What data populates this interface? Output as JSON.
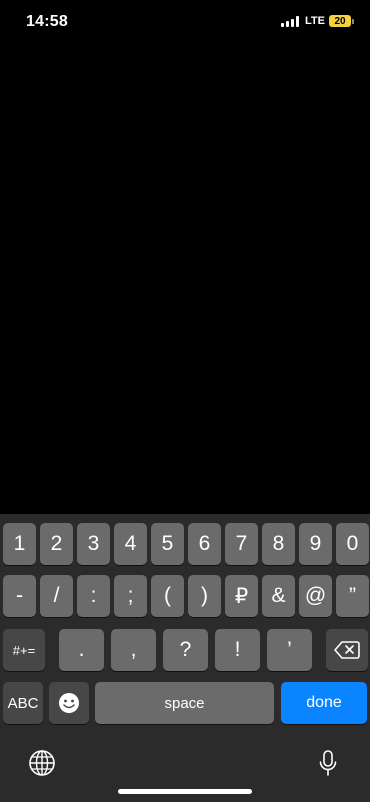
{
  "status_bar": {
    "time": "14:58",
    "network": "LTE",
    "battery": "20",
    "battery_color": "#f6d23c"
  },
  "keyboard": {
    "row1": [
      "1",
      "2",
      "3",
      "4",
      "5",
      "6",
      "7",
      "8",
      "9",
      "0"
    ],
    "row2": [
      "-",
      "/",
      ":",
      ";",
      "(",
      ")",
      "₽",
      "&",
      "@",
      "”"
    ],
    "row3": {
      "mode_key": "#+=",
      "keys": [
        ".",
        ",",
        "?",
        "!",
        "’"
      ],
      "delete_icon": "backspace-icon"
    },
    "row4": {
      "abc": "ABC",
      "emoji_icon": "emoji-icon",
      "space": "space",
      "done": "done"
    },
    "bottom": {
      "globe_icon": "globe-icon",
      "mic_icon": "microphone-icon"
    },
    "colors": {
      "background": "#2b2b2b",
      "key": "#6b6b6b",
      "key_dark": "#474747",
      "done": "#0a84ff"
    }
  }
}
